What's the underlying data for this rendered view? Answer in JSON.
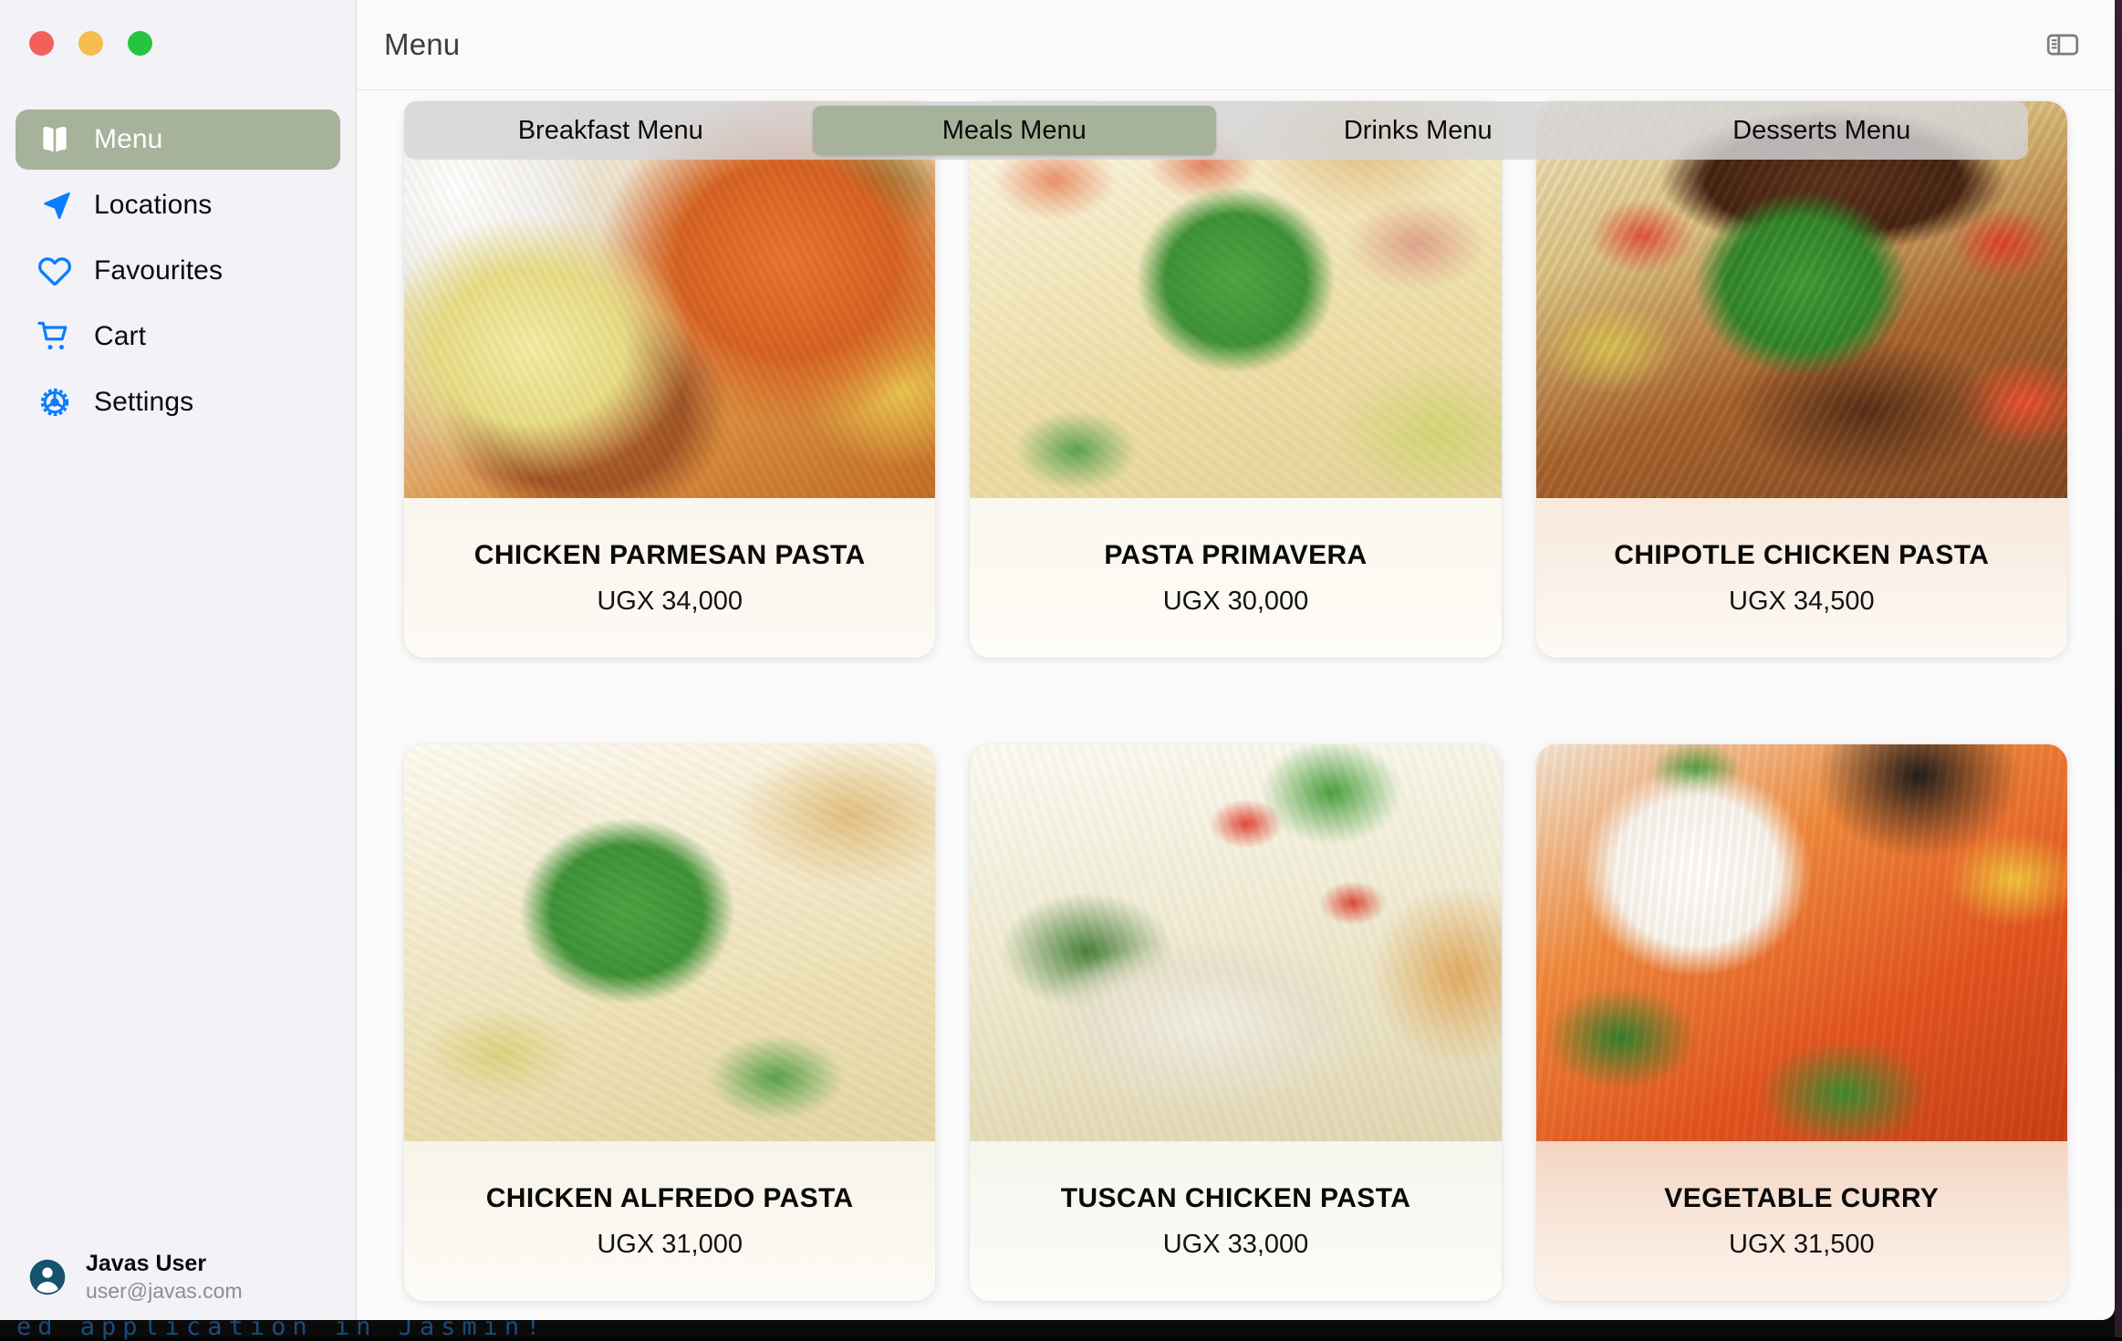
{
  "window": {
    "traffic_lights": [
      "close",
      "minimize",
      "zoom"
    ],
    "colors": {
      "accent_sage": "#A6B29A",
      "sidebar_bg": "#F2F2F7",
      "main_bg": "#FAFAFA",
      "icon_blue": "#0A7CFF",
      "avatar_teal": "#15536E"
    }
  },
  "sidebar": {
    "items": [
      {
        "label": "Menu",
        "icon": "book-icon",
        "active": true
      },
      {
        "label": "Locations",
        "icon": "navigation-icon",
        "active": false
      },
      {
        "label": "Favourites",
        "icon": "heart-icon",
        "active": false
      },
      {
        "label": "Cart",
        "icon": "cart-icon",
        "active": false
      },
      {
        "label": "Settings",
        "icon": "gear-icon",
        "active": false
      }
    ],
    "user": {
      "name": "Javas User",
      "email": "user@javas.com",
      "avatar_icon": "person-circle-icon"
    }
  },
  "header": {
    "title": "Menu",
    "sidebar_toggle_icon": "sidebar-toggle-icon"
  },
  "tabs": [
    {
      "label": "Breakfast Menu",
      "selected": false
    },
    {
      "label": "Meals Menu",
      "selected": true
    },
    {
      "label": "Drinks Menu",
      "selected": false
    },
    {
      "label": "Desserts Menu",
      "selected": false
    }
  ],
  "menu_items": [
    {
      "title": "CHICKEN PARMESAN PASTA",
      "price": "UGX 34,000",
      "photo": "chicken-parmesan-pasta"
    },
    {
      "title": "PASTA PRIMAVERA",
      "price": "UGX 30,000",
      "photo": "pasta-primavera"
    },
    {
      "title": "CHIPOTLE CHICKEN PASTA",
      "price": "UGX 34,500",
      "photo": "chipotle-chicken-pasta"
    },
    {
      "title": "CHICKEN ALFREDO PASTA",
      "price": "UGX 31,000",
      "photo": "chicken-alfredo-pasta"
    },
    {
      "title": "TUSCAN CHICKEN PASTA",
      "price": "UGX 33,000",
      "photo": "tuscan-chicken-pasta"
    },
    {
      "title": "VEGETABLE CURRY",
      "price": "UGX 31,500",
      "photo": "vegetable-curry"
    }
  ],
  "background_app": {
    "visible_text": "ed application in Jasmin!"
  }
}
